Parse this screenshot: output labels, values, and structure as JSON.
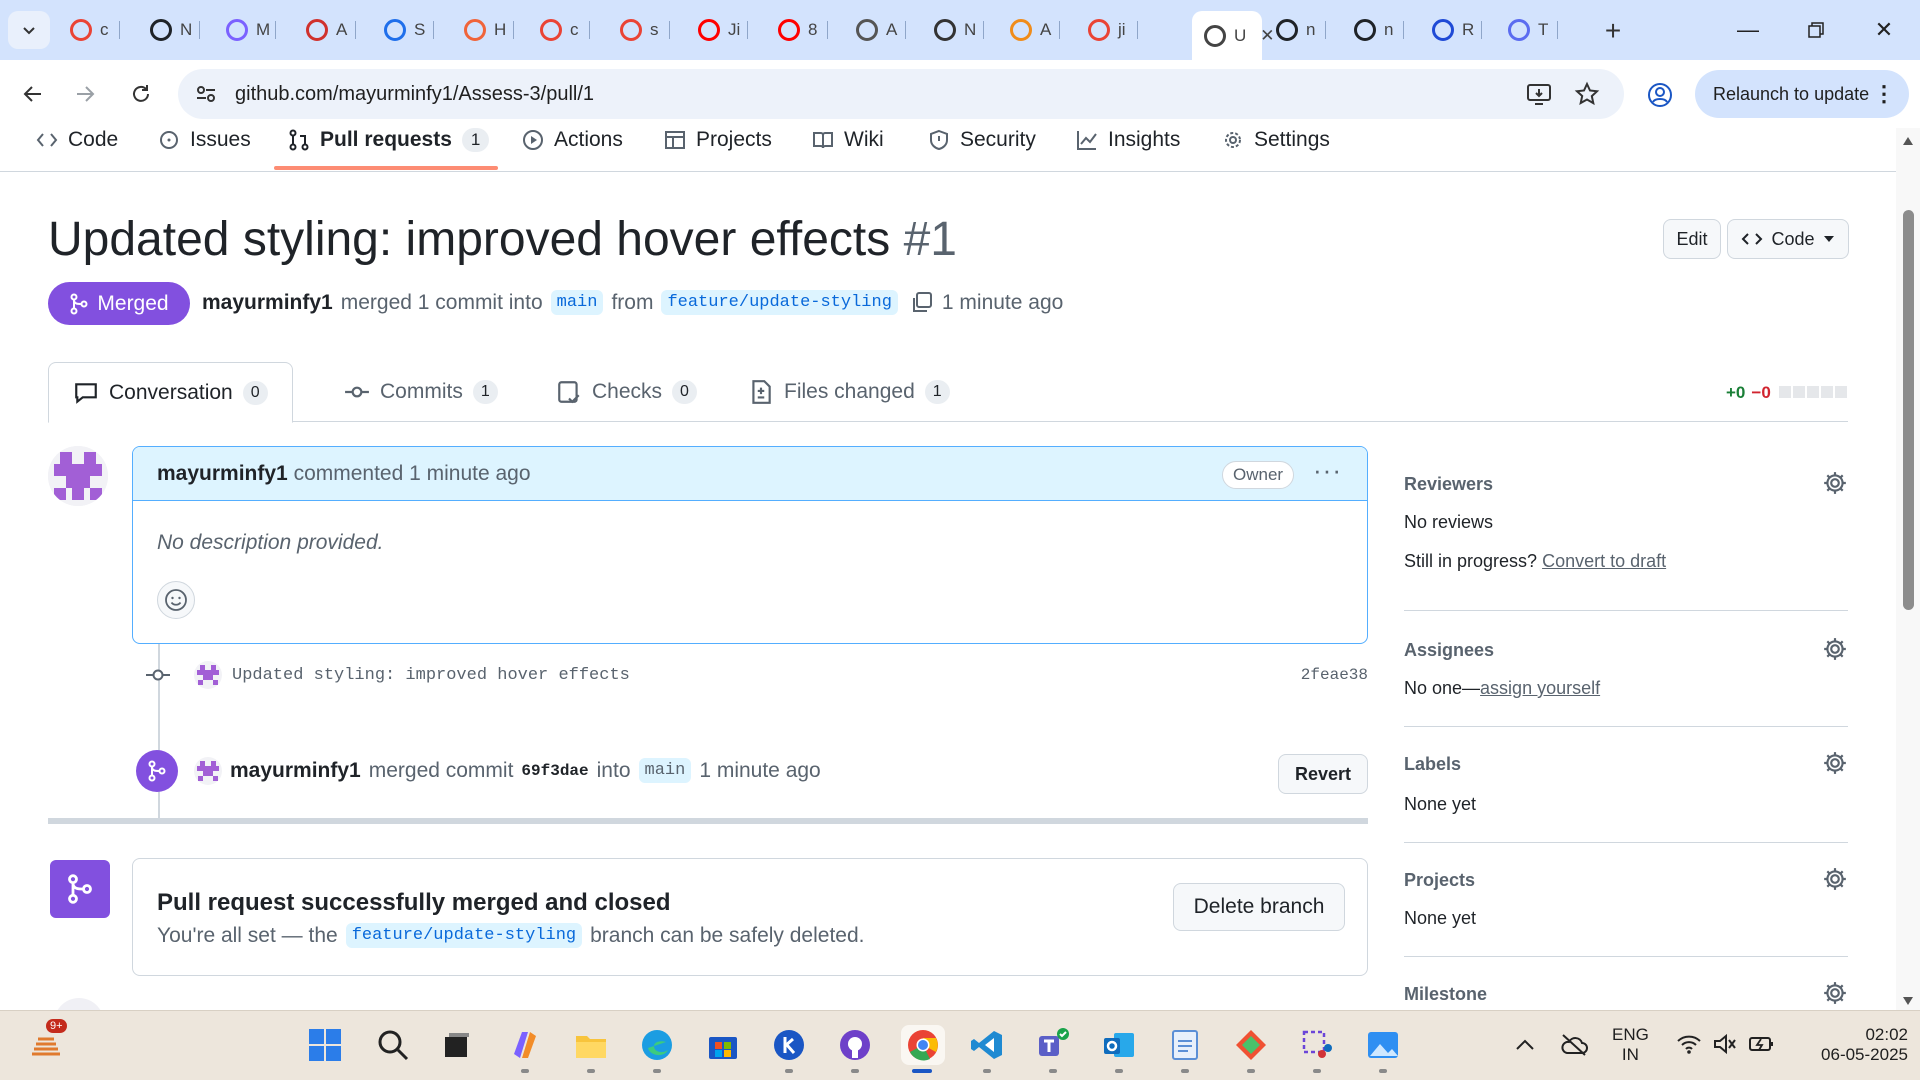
{
  "browser": {
    "tabs": [
      {
        "letter": "c",
        "color": "#ea4335",
        "icon": "google-icon"
      },
      {
        "letter": "N",
        "color": "#1f2328",
        "icon": "github-icon"
      },
      {
        "letter": "M",
        "color": "#7b61ff",
        "icon": "copilot-icon"
      },
      {
        "letter": "A",
        "color": "#d0312d",
        "icon": "app-icon"
      },
      {
        "letter": "S",
        "color": "#1f6feb",
        "icon": "app-icon"
      },
      {
        "letter": "H",
        "color": "#f0643a",
        "icon": "app-icon"
      },
      {
        "letter": "c",
        "color": "#ea4335",
        "icon": "google-icon"
      },
      {
        "letter": "s",
        "color": "#ea4335",
        "icon": "google-icon"
      },
      {
        "letter": "Ji",
        "color": "#ff0000",
        "icon": "youtube-icon"
      },
      {
        "letter": "8",
        "color": "#ff0000",
        "icon": "youtube-icon"
      },
      {
        "letter": "A",
        "color": "#555555",
        "icon": "globe-icon"
      },
      {
        "letter": "N",
        "color": "#333333",
        "icon": "app-icon"
      },
      {
        "letter": "A",
        "color": "#f08c1a",
        "icon": "app-icon"
      },
      {
        "letter": "ji",
        "color": "#ea4335",
        "icon": "google-icon"
      },
      {
        "letter": "U",
        "color": "#444444",
        "icon": "tab-icon",
        "active": true
      },
      {
        "letter": "n",
        "color": "#1f2328",
        "icon": "github-icon"
      },
      {
        "letter": "n",
        "color": "#1f2328",
        "icon": "github-icon"
      },
      {
        "letter": "R",
        "color": "#1f4ad6",
        "icon": "app-icon"
      },
      {
        "letter": "T",
        "color": "#5b6cf0",
        "icon": "app-icon"
      }
    ],
    "url": "github.com/mayurminfy1/Assess-3/pull/1",
    "relaunch_label": "Relaunch to update"
  },
  "repo_nav": {
    "items": [
      {
        "label": "Code",
        "icon": "code-icon"
      },
      {
        "label": "Issues",
        "icon": "issue-icon"
      },
      {
        "label": "Pull requests",
        "icon": "pull-request-icon",
        "count": "1",
        "active": true
      },
      {
        "label": "Actions",
        "icon": "play-icon"
      },
      {
        "label": "Projects",
        "icon": "table-icon"
      },
      {
        "label": "Wiki",
        "icon": "book-icon"
      },
      {
        "label": "Security",
        "icon": "shield-icon"
      },
      {
        "label": "Insights",
        "icon": "graph-icon"
      },
      {
        "label": "Settings",
        "icon": "gear-icon"
      }
    ]
  },
  "pr": {
    "title": "Updated styling: improved hover effects",
    "number": "#1",
    "edit_label": "Edit",
    "code_label": "Code",
    "state": "Merged",
    "author": "mayurminfy1",
    "merged_text": "merged 1 commit into",
    "base_branch": "main",
    "from_text": "from",
    "head_branch": "feature/update-styling",
    "time": "1 minute ago"
  },
  "pr_tabs": [
    {
      "label": "Conversation",
      "count": "0",
      "icon": "comment-icon"
    },
    {
      "label": "Commits",
      "count": "1",
      "icon": "commit-icon"
    },
    {
      "label": "Checks",
      "count": "0",
      "icon": "checklist-icon"
    },
    {
      "label": "Files changed",
      "count": "1",
      "icon": "file-diff-icon"
    }
  ],
  "diffstat": {
    "additions": "+0",
    "deletions": "−0"
  },
  "comment": {
    "author": "mayurminfy1",
    "action": "commented 1 minute ago",
    "badge": "Owner",
    "body": "No description provided."
  },
  "commit": {
    "message": "Updated styling: improved hover effects",
    "sha": "2feae38"
  },
  "merge_event": {
    "user": "mayurminfy1",
    "text1": "merged commit",
    "sha": "69f3dae",
    "text2": "into",
    "branch": "main",
    "time": "1 minute ago",
    "revert_label": "Revert"
  },
  "merged_box": {
    "heading": "Pull request successfully merged and closed",
    "sub_before": "You're all set — the",
    "branch": "feature/update-styling",
    "sub_after": "branch can be safely deleted.",
    "delete_label": "Delete branch"
  },
  "sidebar": {
    "reviewers": {
      "label": "Reviewers",
      "value": "No reviews",
      "progress_text": "Still in progress?",
      "draft_link": "Convert to draft"
    },
    "assignees": {
      "label": "Assignees",
      "value": "No one—",
      "assign_link": "assign yourself"
    },
    "labels": {
      "label": "Labels",
      "value": "None yet"
    },
    "projects": {
      "label": "Projects",
      "value": "None yet"
    },
    "milestone": {
      "label": "Milestone"
    }
  },
  "taskbar": {
    "notification_badge": "9+",
    "lang": "ENG",
    "region": "IN",
    "time": "02:02",
    "date": "06-05-2025"
  }
}
